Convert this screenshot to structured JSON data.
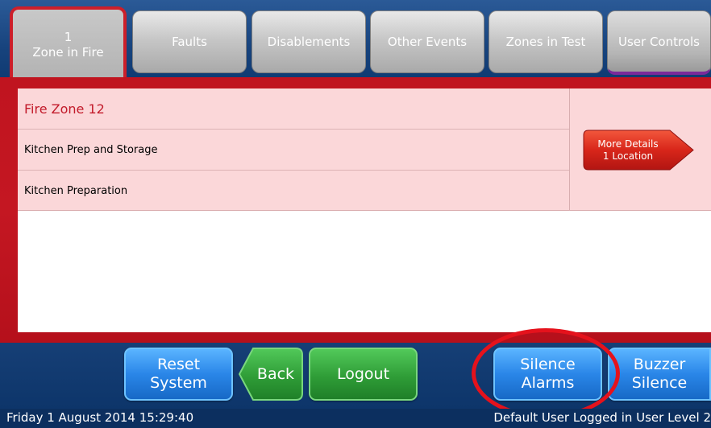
{
  "tabs": {
    "zone_in_fire": {
      "count": "1",
      "label": "Zone in Fire"
    },
    "faults": "Faults",
    "disablements": "Disablements",
    "other_events": "Other Events",
    "zones_in_test": "Zones in Test",
    "user_controls": "User Controls"
  },
  "event": {
    "zone": "Fire Zone 12",
    "rows": [
      "Kitchen Prep and Storage",
      "Kitchen Preparation"
    ],
    "more_details": {
      "line1": "More Details",
      "line2": "1 Location"
    }
  },
  "buttons": {
    "reset": {
      "line1": "Reset",
      "line2": "System"
    },
    "back": "Back",
    "logout": "Logout",
    "silence": {
      "line1": "Silence",
      "line2": "Alarms"
    },
    "buzzer": {
      "line1": "Buzzer",
      "line2": "Silence"
    }
  },
  "status": {
    "datetime": "Friday 1 August 2014 15:29:40",
    "user": "Default User Logged in User Level 2"
  },
  "colors": {
    "alarm_red": "#c0141f",
    "event_background": "#fbd7d9",
    "button_blue": "#2a86e8",
    "button_green": "#2f9d37",
    "highlight_circle": "#e5121c"
  }
}
